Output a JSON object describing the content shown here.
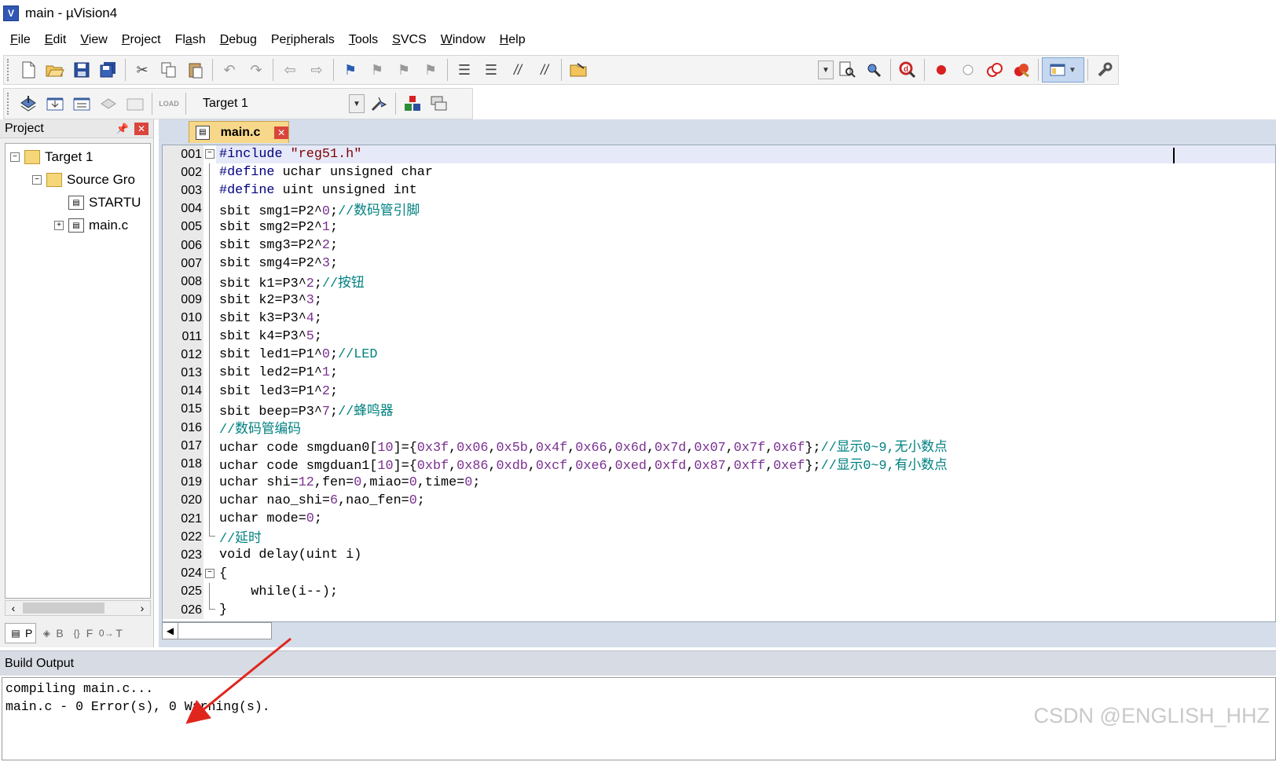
{
  "window": {
    "title": "main  - µVision4",
    "app_icon_label": "V"
  },
  "menu": [
    {
      "label": "File",
      "hotkey": "F",
      "rest": "ile"
    },
    {
      "label": "Edit",
      "hotkey": "E",
      "rest": "dit"
    },
    {
      "label": "View",
      "hotkey": "V",
      "rest": "iew"
    },
    {
      "label": "Project",
      "hotkey": "P",
      "rest": "roject"
    },
    {
      "label": "Flash",
      "hotkey": "a",
      "pre": "Fl",
      "rest": "sh"
    },
    {
      "label": "Debug",
      "hotkey": "D",
      "rest": "ebug"
    },
    {
      "label": "Peripherals",
      "hotkey": "r",
      "pre": "Pe",
      "rest": "ipherals"
    },
    {
      "label": "Tools",
      "hotkey": "T",
      "rest": "ools"
    },
    {
      "label": "SVCS",
      "hotkey": "S",
      "rest": "VCS"
    },
    {
      "label": "Window",
      "hotkey": "W",
      "rest": "indow"
    },
    {
      "label": "Help",
      "hotkey": "H",
      "rest": "elp"
    }
  ],
  "toolbar2": {
    "target_value": "Target 1"
  },
  "project_panel": {
    "title": "Project",
    "tree": [
      {
        "label": "Target 1",
        "level": 0,
        "expander": "−",
        "icon": "target-icon"
      },
      {
        "label": "Source Gro",
        "level": 1,
        "expander": "−",
        "icon": "folder-icon"
      },
      {
        "label": "STARTU",
        "level": 2,
        "expander": "",
        "icon": "file-icon"
      },
      {
        "label": "main.c",
        "level": 2,
        "expander": "+",
        "icon": "file-icon"
      }
    ],
    "tabs": [
      {
        "label": "P",
        "icon": "project-tab-icon"
      },
      {
        "label": "B",
        "icon": "books-tab-icon"
      },
      {
        "label": "F",
        "icon": "functions-tab-icon"
      },
      {
        "label": "T",
        "icon": "templates-tab-icon"
      }
    ]
  },
  "editor": {
    "file_tab": "main.c",
    "lines": [
      {
        "num": "001",
        "fold": "box-minus",
        "current": true,
        "tokens": [
          [
            "pp",
            "#include "
          ],
          [
            "str",
            "\"reg51.h\""
          ]
        ]
      },
      {
        "num": "002",
        "fold": "line",
        "tokens": [
          [
            "pp",
            "#define "
          ],
          [
            "kw",
            "uchar unsigned char"
          ]
        ]
      },
      {
        "num": "003",
        "fold": "line",
        "tokens": [
          [
            "pp",
            "#define "
          ],
          [
            "kw",
            "uint unsigned int"
          ]
        ]
      },
      {
        "num": "004",
        "fold": "line",
        "tokens": [
          [
            "kw",
            "sbit smg1=P2^"
          ],
          [
            "num",
            "0"
          ],
          [
            "kw",
            ";"
          ],
          [
            "cm",
            "//"
          ],
          [
            "cn",
            "数码管引脚"
          ]
        ]
      },
      {
        "num": "005",
        "fold": "line",
        "tokens": [
          [
            "kw",
            "sbit smg2=P2^"
          ],
          [
            "num",
            "1"
          ],
          [
            "kw",
            ";"
          ]
        ]
      },
      {
        "num": "006",
        "fold": "line",
        "tokens": [
          [
            "kw",
            "sbit smg3=P2^"
          ],
          [
            "num",
            "2"
          ],
          [
            "kw",
            ";"
          ]
        ]
      },
      {
        "num": "007",
        "fold": "line",
        "tokens": [
          [
            "kw",
            "sbit smg4=P2^"
          ],
          [
            "num",
            "3"
          ],
          [
            "kw",
            ";"
          ]
        ]
      },
      {
        "num": "008",
        "fold": "line",
        "tokens": [
          [
            "kw",
            "sbit k1=P3^"
          ],
          [
            "num",
            "2"
          ],
          [
            "kw",
            ";"
          ],
          [
            "cm",
            "//"
          ],
          [
            "cn",
            "按钮"
          ]
        ]
      },
      {
        "num": "009",
        "fold": "line",
        "tokens": [
          [
            "kw",
            "sbit k2=P3^"
          ],
          [
            "num",
            "3"
          ],
          [
            "kw",
            ";"
          ]
        ]
      },
      {
        "num": "010",
        "fold": "line",
        "tokens": [
          [
            "kw",
            "sbit k3=P3^"
          ],
          [
            "num",
            "4"
          ],
          [
            "kw",
            ";"
          ]
        ]
      },
      {
        "num": "011",
        "fold": "line",
        "tokens": [
          [
            "kw",
            "sbit k4=P3^"
          ],
          [
            "num",
            "5"
          ],
          [
            "kw",
            ";"
          ]
        ]
      },
      {
        "num": "012",
        "fold": "line",
        "tokens": [
          [
            "kw",
            "sbit led1=P1^"
          ],
          [
            "num",
            "0"
          ],
          [
            "kw",
            ";"
          ],
          [
            "cm",
            "//LED"
          ]
        ]
      },
      {
        "num": "013",
        "fold": "line",
        "tokens": [
          [
            "kw",
            "sbit led2=P1^"
          ],
          [
            "num",
            "1"
          ],
          [
            "kw",
            ";"
          ]
        ]
      },
      {
        "num": "014",
        "fold": "line",
        "tokens": [
          [
            "kw",
            "sbit led3=P1^"
          ],
          [
            "num",
            "2"
          ],
          [
            "kw",
            ";"
          ]
        ]
      },
      {
        "num": "015",
        "fold": "line",
        "tokens": [
          [
            "kw",
            "sbit beep=P3^"
          ],
          [
            "num",
            "7"
          ],
          [
            "kw",
            ";"
          ],
          [
            "cm",
            "//"
          ],
          [
            "cn",
            "蜂鸣器"
          ]
        ]
      },
      {
        "num": "016",
        "fold": "line",
        "tokens": [
          [
            "cm",
            "//"
          ],
          [
            "cn",
            "数码管编码"
          ]
        ]
      },
      {
        "num": "017",
        "fold": "line",
        "tokens": [
          [
            "kw",
            "uchar code smgduan0["
          ],
          [
            "num",
            "10"
          ],
          [
            "kw",
            "]={"
          ],
          [
            "num",
            "0x3f"
          ],
          [
            "kw",
            ","
          ],
          [
            "num",
            "0x06"
          ],
          [
            "kw",
            ","
          ],
          [
            "num",
            "0x5b"
          ],
          [
            "kw",
            ","
          ],
          [
            "num",
            "0x4f"
          ],
          [
            "kw",
            ","
          ],
          [
            "num",
            "0x66"
          ],
          [
            "kw",
            ","
          ],
          [
            "num",
            "0x6d"
          ],
          [
            "kw",
            ","
          ],
          [
            "num",
            "0x7d"
          ],
          [
            "kw",
            ","
          ],
          [
            "num",
            "0x07"
          ],
          [
            "kw",
            ","
          ],
          [
            "num",
            "0x7f"
          ],
          [
            "kw",
            ","
          ],
          [
            "num",
            "0x6f"
          ],
          [
            "kw",
            "};"
          ],
          [
            "cm",
            "//"
          ],
          [
            "cn",
            "显示"
          ],
          [
            "cm",
            "0~9,"
          ],
          [
            "cn",
            "无小数点"
          ]
        ]
      },
      {
        "num": "018",
        "fold": "line",
        "tokens": [
          [
            "kw",
            "uchar code smgduan1["
          ],
          [
            "num",
            "10"
          ],
          [
            "kw",
            "]={"
          ],
          [
            "num",
            "0xbf"
          ],
          [
            "kw",
            ","
          ],
          [
            "num",
            "0x86"
          ],
          [
            "kw",
            ","
          ],
          [
            "num",
            "0xdb"
          ],
          [
            "kw",
            ","
          ],
          [
            "num",
            "0xcf"
          ],
          [
            "kw",
            ","
          ],
          [
            "num",
            "0xe6"
          ],
          [
            "kw",
            ","
          ],
          [
            "num",
            "0xed"
          ],
          [
            "kw",
            ","
          ],
          [
            "num",
            "0xfd"
          ],
          [
            "kw",
            ","
          ],
          [
            "num",
            "0x87"
          ],
          [
            "kw",
            ","
          ],
          [
            "num",
            "0xff"
          ],
          [
            "kw",
            ","
          ],
          [
            "num",
            "0xef"
          ],
          [
            "kw",
            "};"
          ],
          [
            "cm",
            "//"
          ],
          [
            "cn",
            "显示"
          ],
          [
            "cm",
            "0~9,"
          ],
          [
            "cn",
            "有小数点"
          ]
        ]
      },
      {
        "num": "019",
        "fold": "line",
        "tokens": [
          [
            "kw",
            "uchar shi="
          ],
          [
            "num",
            "12"
          ],
          [
            "kw",
            ",fen="
          ],
          [
            "num",
            "0"
          ],
          [
            "kw",
            ",miao="
          ],
          [
            "num",
            "0"
          ],
          [
            "kw",
            ",time="
          ],
          [
            "num",
            "0"
          ],
          [
            "kw",
            ";"
          ]
        ]
      },
      {
        "num": "020",
        "fold": "line",
        "tokens": [
          [
            "kw",
            "uchar nao_shi="
          ],
          [
            "num",
            "6"
          ],
          [
            "kw",
            ",nao_fen="
          ],
          [
            "num",
            "0"
          ],
          [
            "kw",
            ";"
          ]
        ]
      },
      {
        "num": "021",
        "fold": "line",
        "tokens": [
          [
            "kw",
            "uchar mode="
          ],
          [
            "num",
            "0"
          ],
          [
            "kw",
            ";"
          ]
        ]
      },
      {
        "num": "022",
        "fold": "end",
        "tokens": [
          [
            "cm",
            "//"
          ],
          [
            "cn",
            "延时"
          ]
        ]
      },
      {
        "num": "023",
        "fold": "",
        "tokens": [
          [
            "kw",
            "void delay(uint i)"
          ]
        ]
      },
      {
        "num": "024",
        "fold": "box-minus",
        "tokens": [
          [
            "kw",
            "{"
          ]
        ]
      },
      {
        "num": "025",
        "fold": "line",
        "tokens": [
          [
            "kw",
            "    while(i--);"
          ]
        ]
      },
      {
        "num": "026",
        "fold": "end",
        "tokens": [
          [
            "kw",
            "}"
          ]
        ]
      }
    ]
  },
  "build_output": {
    "title": "Build Output",
    "lines": [
      "compiling main.c...",
      "main.c - 0 Error(s), 0 Warning(s)."
    ]
  },
  "watermark": "CSDN @ENGLISH_HHZ",
  "colors": {
    "comment": "#008080",
    "number": "#7a2f90",
    "preprocessor": "#000080",
    "string": "#800000",
    "arrow": "#e0261c",
    "tab_active": "#f7d88a"
  }
}
